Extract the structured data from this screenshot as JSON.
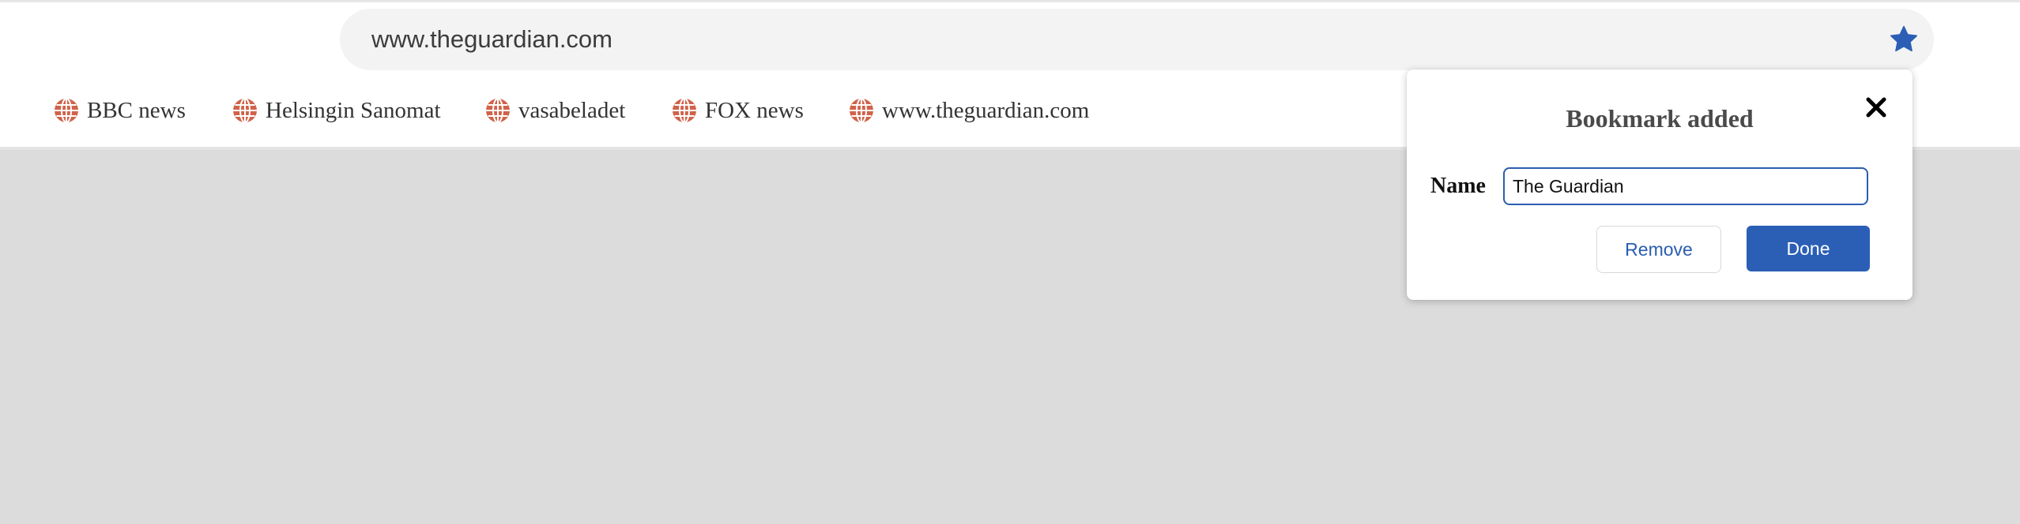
{
  "address_bar": {
    "url": "www.theguardian.com",
    "star_icon": "star-filled-icon",
    "star_color": "#2b5fb6"
  },
  "bookmarks_bar": {
    "icon": "globe-icon",
    "icon_color": "#d0634b",
    "items": [
      {
        "label": "BBC news"
      },
      {
        "label": "Helsingin Sanomat"
      },
      {
        "label": "vasabeladet"
      },
      {
        "label": "FOX news"
      },
      {
        "label": "www.theguardian.com"
      }
    ]
  },
  "bookmark_popup": {
    "title": "Bookmark added",
    "close_icon": "close-icon",
    "name_label": "Name",
    "name_value": "The Guardian",
    "remove_label": "Remove",
    "done_label": "Done",
    "accent_color": "#2b5fb6"
  },
  "content_background": "#dcdcdc"
}
